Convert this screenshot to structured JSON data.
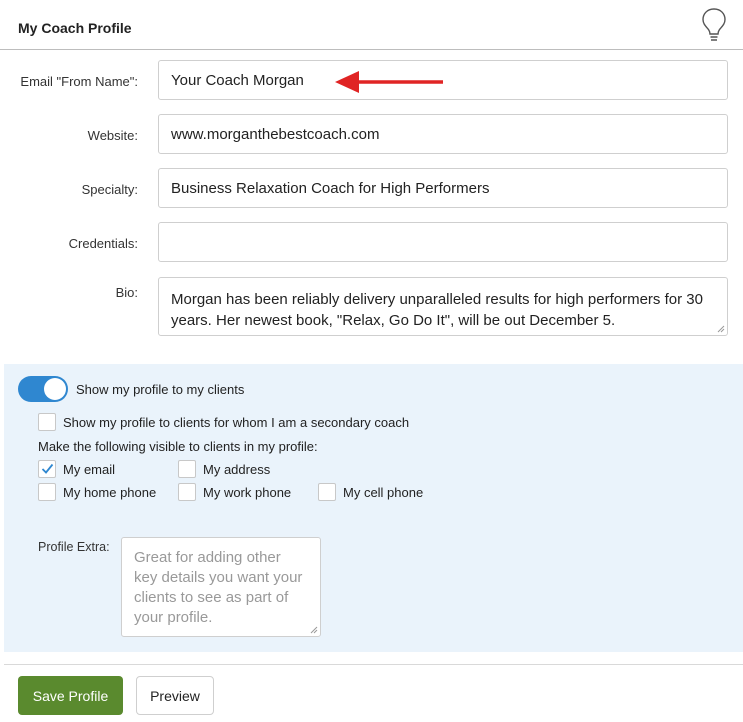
{
  "header": {
    "title": "My Coach Profile",
    "icon": "lightbulb-icon"
  },
  "form": {
    "from_name": {
      "label": "Email \"From Name\":",
      "value": "Your Coach Morgan"
    },
    "website": {
      "label": "Website:",
      "value": "www.morganthebestcoach.com"
    },
    "specialty": {
      "label": "Specialty:",
      "value": "Business Relaxation Coach for High Performers"
    },
    "credentials": {
      "label": "Credentials:",
      "value": ""
    },
    "bio": {
      "label": "Bio:",
      "value": "Morgan has been reliably delivery unparalleled results for high performers for 30 years. Her newest book, \"Relax, Go Do It\", will be out December 5."
    }
  },
  "annotation": {
    "arrow_color": "#e02424"
  },
  "visibility": {
    "toggle": {
      "label": "Show my profile to my clients",
      "on": true
    },
    "secondary": {
      "label": "Show my profile to clients for whom I am a secondary coach",
      "checked": false
    },
    "heading": "Make the following visible to clients in my profile:",
    "options": {
      "email": {
        "label": "My email",
        "checked": true
      },
      "address": {
        "label": "My address",
        "checked": false
      },
      "home_phone": {
        "label": "My home phone",
        "checked": false
      },
      "work_phone": {
        "label": "My work phone",
        "checked": false
      },
      "cell_phone": {
        "label": "My cell phone",
        "checked": false
      }
    },
    "extra": {
      "label": "Profile Extra:",
      "placeholder": "Great for adding other key details you want your clients to see as part of your profile."
    }
  },
  "actions": {
    "save": "Save Profile",
    "preview": "Preview"
  },
  "colors": {
    "accent": "#2f87d0",
    "save": "#5a8a2e",
    "panel": "#eaf3fb"
  }
}
